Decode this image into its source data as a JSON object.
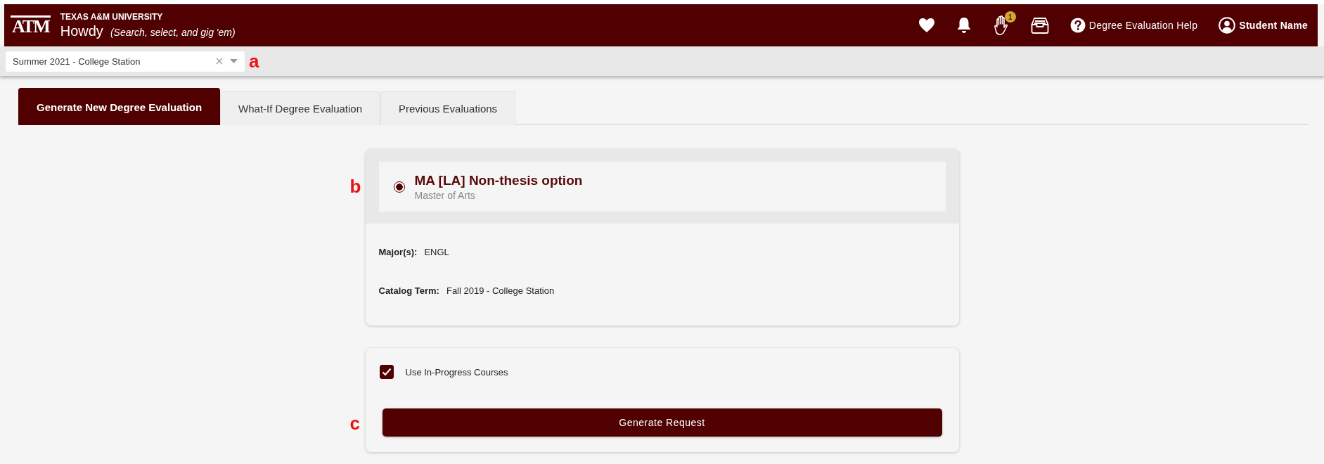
{
  "header": {
    "logo": "ATM",
    "university": "TEXAS A&M UNIVERSITY",
    "app_name": "Howdy",
    "tagline": "(Search, select, and gig 'em)",
    "notification_badge": "1",
    "help_link": "Degree Evaluation Help",
    "user_name": "Student Name"
  },
  "term_select": {
    "value": "Summer 2021 - College Station",
    "annotation": "a"
  },
  "tabs": [
    {
      "label": "Generate New Degree Evaluation",
      "selected": true
    },
    {
      "label": "What-If Degree Evaluation",
      "selected": false
    },
    {
      "label": "Previous Evaluations",
      "selected": false
    }
  ],
  "program": {
    "annotation": "b",
    "title": "MA [LA] Non-thesis option",
    "subtitle": "Master of Arts",
    "selected": true,
    "fields": [
      {
        "label": "Major(s):",
        "value": "ENGL"
      },
      {
        "label": "Catalog Term:",
        "value": "Fall 2019 - College Station"
      }
    ]
  },
  "options": {
    "annotation": "c",
    "use_in_progress": {
      "label": "Use In-Progress Courses",
      "checked": true
    },
    "generate_button": "Generate Request"
  }
}
